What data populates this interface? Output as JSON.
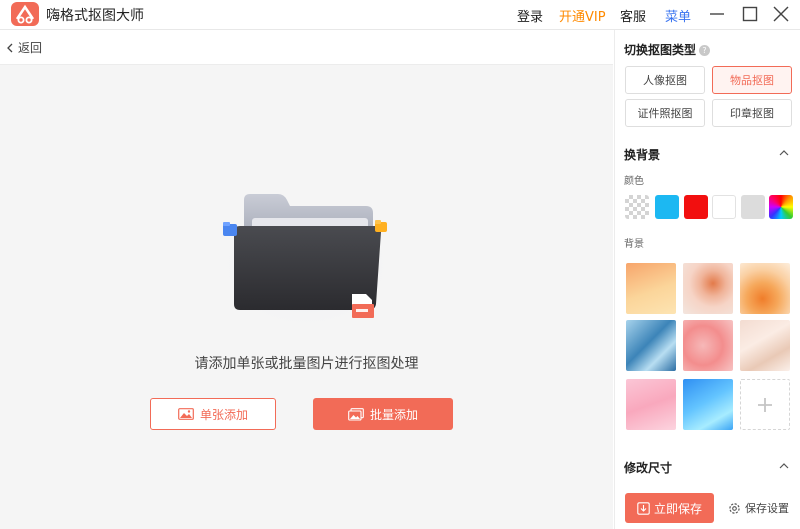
{
  "app": {
    "title": "嗨格式抠图大师"
  },
  "titlebar": {
    "login": "登录",
    "vip": "开通VIP",
    "service": "客服",
    "menu": "菜单"
  },
  "main": {
    "back_label": "返回",
    "hint": "请添加单张或批量图片进行抠图处理",
    "single_add_label": "单张添加",
    "batch_add_label": "批量添加"
  },
  "panel": {
    "switch_type_title": "切换抠图类型",
    "types": [
      {
        "label": "人像抠图",
        "active": false
      },
      {
        "label": "物品抠图",
        "active": true
      },
      {
        "label": "证件照抠图",
        "active": false
      },
      {
        "label": "印章抠图",
        "active": false
      }
    ],
    "bg_section_title": "换背景",
    "color_label": "颜色",
    "colors": [
      "transparent",
      "#1cb8f2",
      "#f20f0f",
      "#ffffff",
      "#dcdcdc",
      "rainbow"
    ],
    "background_label": "背景",
    "resize_title": "修改尺寸",
    "save_now_label": "立即保存",
    "save_settings_label": "保存设置"
  },
  "colors": {
    "accent": "#f26b57",
    "vip": "#ff8a00",
    "menu": "#3a74f0"
  }
}
